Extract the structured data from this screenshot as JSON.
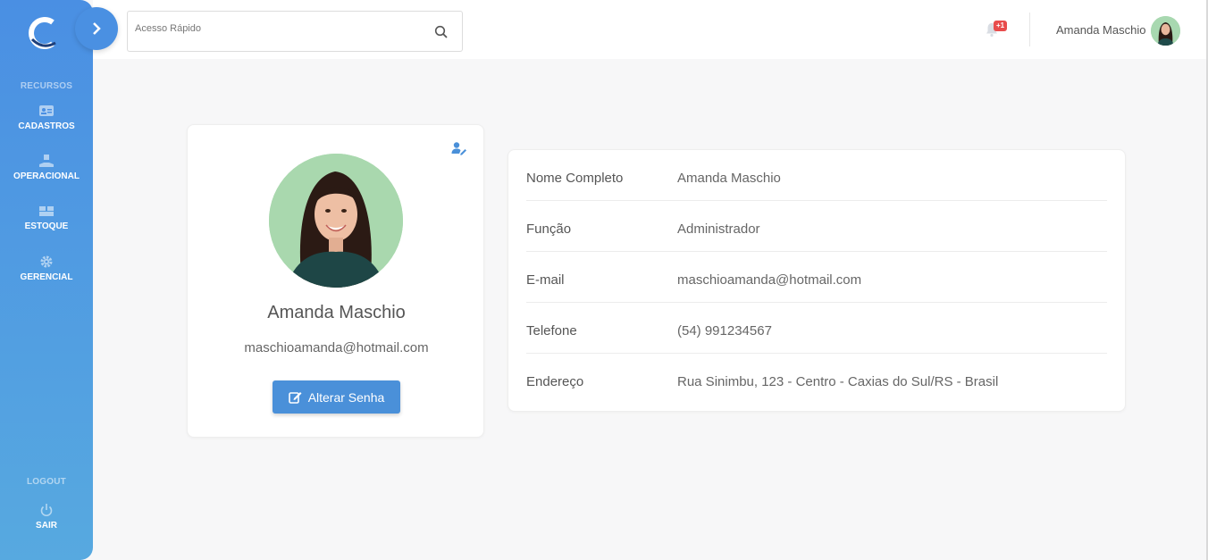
{
  "sidebar": {
    "section_resources": "RECURSOS",
    "items": [
      {
        "label": "CADASTROS",
        "icon": "id-card-icon"
      },
      {
        "label": "OPERACIONAL",
        "icon": "hand-box-icon"
      },
      {
        "label": "ESTOQUE",
        "icon": "boxes-icon"
      },
      {
        "label": "GERENCIAL",
        "icon": "gear-icon"
      }
    ],
    "section_logout": "LOGOUT",
    "logout_label": "SAIR"
  },
  "topbar": {
    "search_placeholder": "Acesso Rápido",
    "notification_badge": "+1",
    "user_name": "Amanda Maschio"
  },
  "profile": {
    "name": "Amanda Maschio",
    "email": "maschioamanda@hotmail.com",
    "change_password_label": "Alterar Senha"
  },
  "details": {
    "rows": [
      {
        "label": "Nome Completo",
        "value": "Amanda Maschio"
      },
      {
        "label": "Função",
        "value": "Administrador"
      },
      {
        "label": "E-mail",
        "value": "maschioamanda@hotmail.com"
      },
      {
        "label": "Telefone",
        "value": "(54) 991234567"
      },
      {
        "label": "Endereço",
        "value": "Rua Sinimbu, 123 - Centro - Caxias do Sul/RS - Brasil"
      }
    ]
  },
  "colors": {
    "accent": "#4a90e2",
    "badge": "#e84c4c",
    "avatar_bg": "#a9d8ae"
  }
}
